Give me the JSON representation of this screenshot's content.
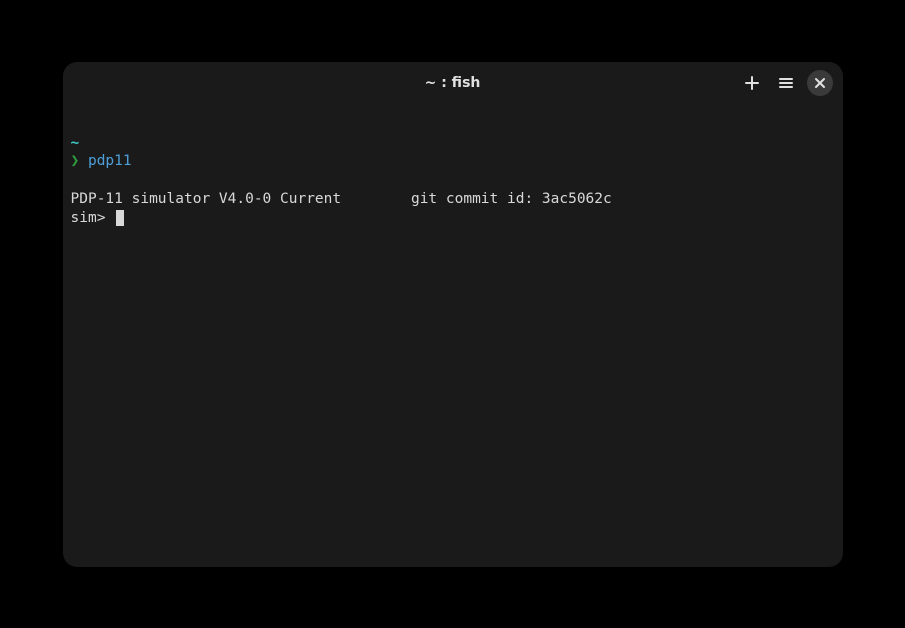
{
  "window": {
    "title": "~ : fish"
  },
  "terminal": {
    "cwd": "~",
    "prompt_char": "❯",
    "command": "pdp11",
    "output_line1": "PDP-11 simulator V4.0-0 Current        git commit id: 3ac5062c",
    "sim_prompt": "sim> "
  },
  "icons": {
    "new_tab": "plus-icon",
    "menu": "hamburger-icon",
    "close": "close-icon"
  }
}
